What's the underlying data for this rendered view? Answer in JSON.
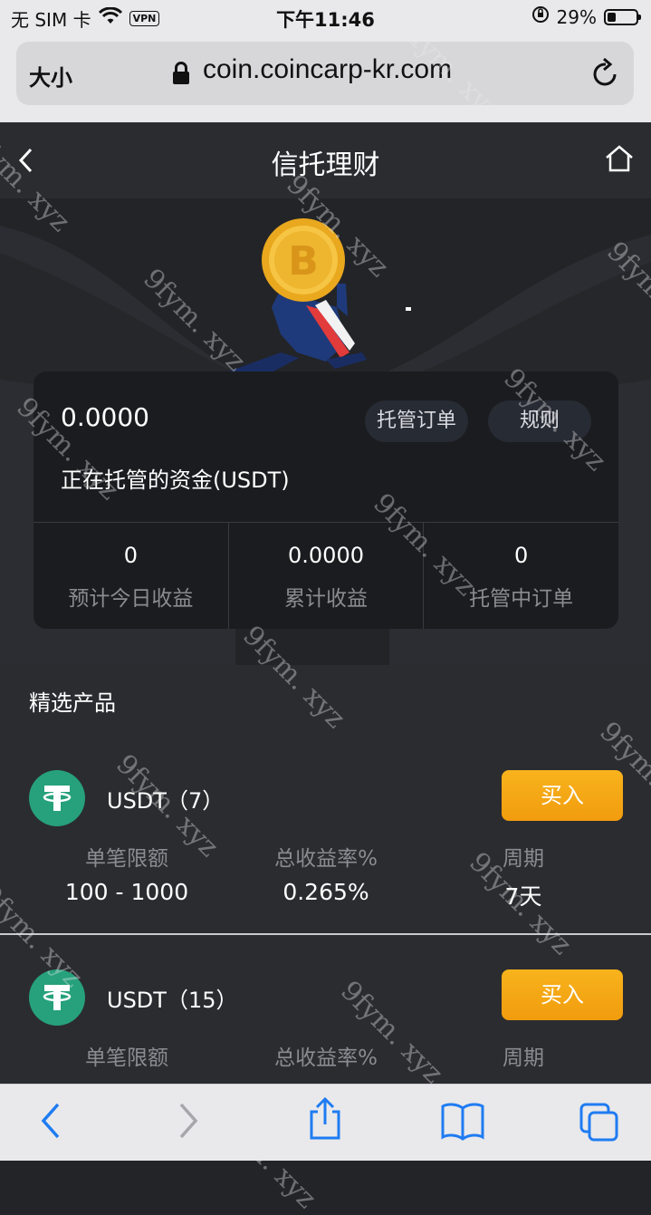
{
  "status_bar": {
    "carrier": "无 SIM 卡",
    "vpn": "VPN",
    "time": "下午11:46",
    "battery": "29%"
  },
  "browser": {
    "text_size_label": "大小",
    "url": "coin.coincarp-kr.com"
  },
  "header": {
    "title": "信托理财"
  },
  "summary": {
    "balance": "0.0000",
    "balance_label": "正在托管的资金(USDT)",
    "orders_button": "托管订单",
    "rules_button": "规则",
    "stats": [
      {
        "value": "0",
        "label": "预计今日收益"
      },
      {
        "value": "0.0000",
        "label": "累计收益"
      },
      {
        "value": "0",
        "label": "托管中订单"
      }
    ]
  },
  "products": {
    "section_title": "精选产品",
    "columns": [
      "单笔限额",
      "总收益率%",
      "周期"
    ],
    "items": [
      {
        "name": "USDT（7）",
        "buy": "买入",
        "limit": "100 - 1000",
        "rate": "0.265%",
        "period": "7天"
      },
      {
        "name": "USDT（15）",
        "buy": "买入",
        "limit": "",
        "rate": "",
        "period": ""
      }
    ]
  },
  "watermark": "9fym. xyz",
  "colors": {
    "accent": "#f5a816",
    "tether": "#26a17b",
    "background": "#232428",
    "card": "#1b1c1f"
  }
}
